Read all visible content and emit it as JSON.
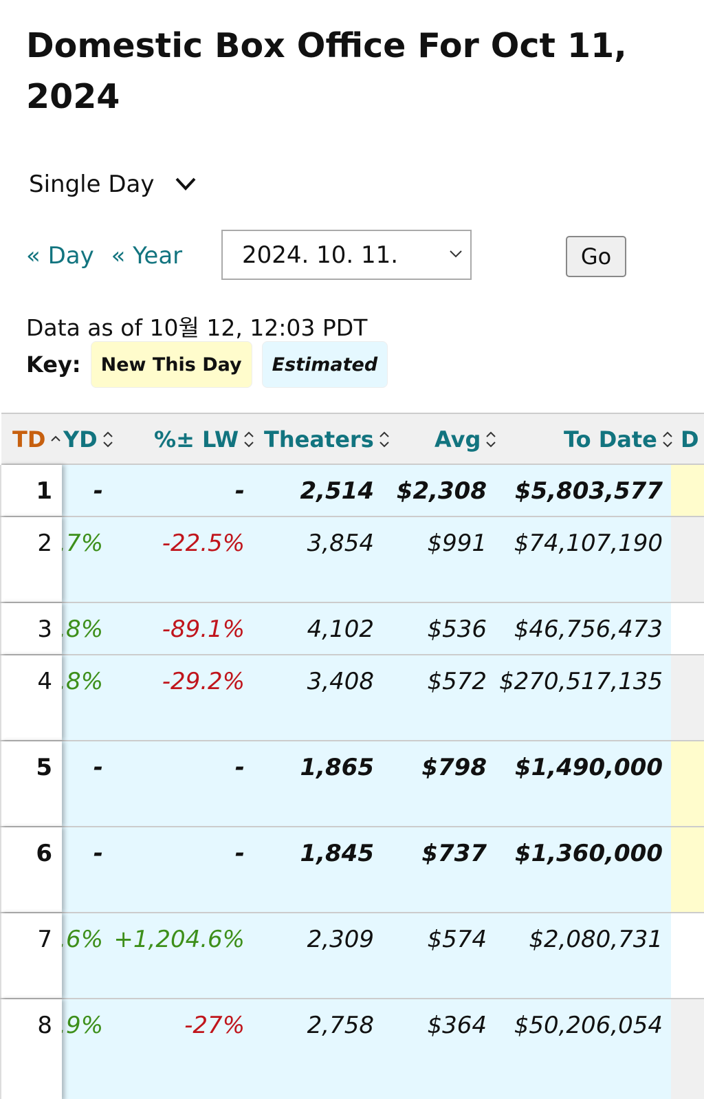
{
  "title": "Domestic Box Office For Oct 11, 2024",
  "period_select": {
    "value": "Single Day"
  },
  "nav": {
    "prev_day": "« Day",
    "prev_year": "« Year"
  },
  "date_select": {
    "value": "2024. 10. 11."
  },
  "go_label": "Go",
  "data_as_of": "Data as of 10월 12, 12:03 PDT",
  "key": {
    "label": "Key:",
    "new": "New This Day",
    "estimated": "Estimated"
  },
  "colors": {
    "accent": "#12747f",
    "sorted": "#c7600f",
    "new": "#fffccc",
    "estimated": "#e5f8ff",
    "positive": "#3d8f1a",
    "negative": "#c0151c"
  },
  "table": {
    "headers": [
      "TD",
      "YD",
      "%± LW",
      "Theaters",
      "Avg",
      "To Date",
      "D"
    ],
    "rows": [
      {
        "td": "1",
        "yd": "-",
        "lw": "-",
        "theaters": "2,514",
        "avg": "$2,308",
        "to_date": "$5,803,577",
        "new": true
      },
      {
        "td": "2",
        "yd": ".7%",
        "lw": "-22.5%",
        "theaters": "3,854",
        "avg": "$991",
        "to_date": "$74,107,190",
        "new": false
      },
      {
        "td": "3",
        "yd": ".8%",
        "lw": "-89.1%",
        "theaters": "4,102",
        "avg": "$536",
        "to_date": "$46,756,473",
        "new": false
      },
      {
        "td": "4",
        "yd": ".8%",
        "lw": "-29.2%",
        "theaters": "3,408",
        "avg": "$572",
        "to_date": "$270,517,135",
        "new": false
      },
      {
        "td": "5",
        "yd": "-",
        "lw": "-",
        "theaters": "1,865",
        "avg": "$798",
        "to_date": "$1,490,000",
        "new": true
      },
      {
        "td": "6",
        "yd": "-",
        "lw": "-",
        "theaters": "1,845",
        "avg": "$737",
        "to_date": "$1,360,000",
        "new": true
      },
      {
        "td": "7",
        "yd": ".6%",
        "lw": "+1,204.6%",
        "theaters": "2,309",
        "avg": "$574",
        "to_date": "$2,080,731",
        "new": false
      },
      {
        "td": "8",
        "yd": ".9%",
        "lw": "-27%",
        "theaters": "2,758",
        "avg": "$364",
        "to_date": "$50,206,054",
        "new": false
      }
    ]
  }
}
